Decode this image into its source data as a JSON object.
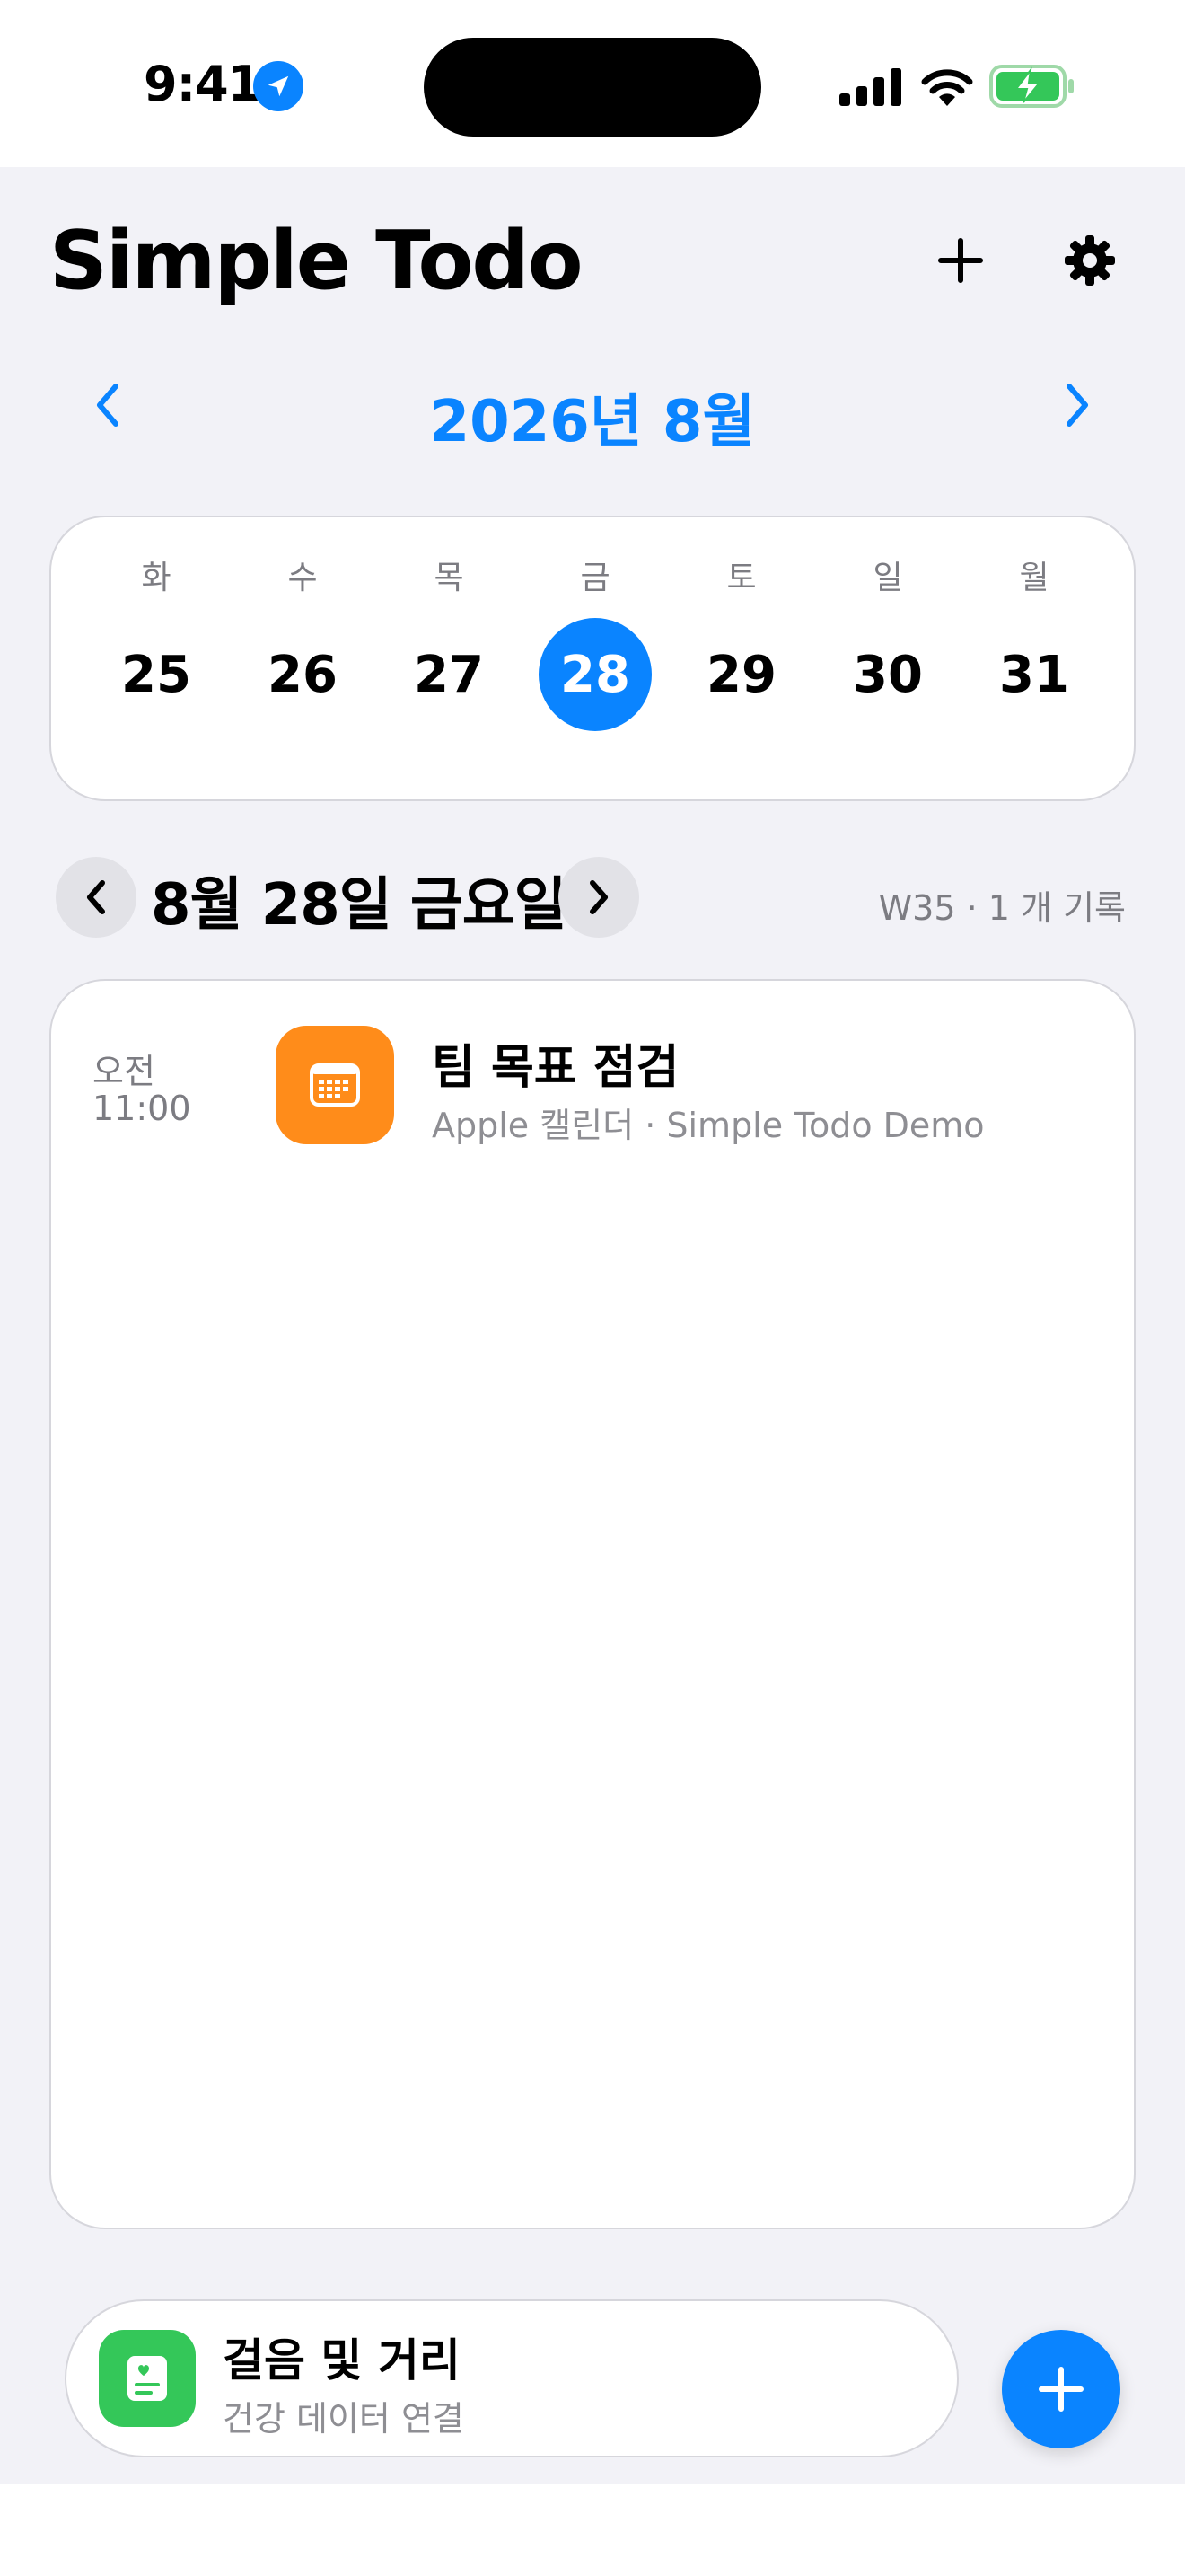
{
  "status_bar": {
    "time": "9:41"
  },
  "header": {
    "title": "Simple Todo"
  },
  "month_nav": {
    "label": "2026년 8월"
  },
  "week": [
    {
      "weekday": "화",
      "day": "25",
      "selected": false
    },
    {
      "weekday": "수",
      "day": "26",
      "selected": false
    },
    {
      "weekday": "목",
      "day": "27",
      "selected": false
    },
    {
      "weekday": "금",
      "day": "28",
      "selected": true
    },
    {
      "weekday": "토",
      "day": "29",
      "selected": false
    },
    {
      "weekday": "일",
      "day": "30",
      "selected": false
    },
    {
      "weekday": "월",
      "day": "31",
      "selected": false
    }
  ],
  "date_nav": {
    "label": "8월 28일 금요일",
    "week_info": "W35 · 1 개 기록"
  },
  "events": [
    {
      "ampm": "오전",
      "time": "11:00",
      "title": "팀 목표 점검",
      "subtitle": "Apple 캘린더 · Simple Todo Demo"
    }
  ],
  "health": {
    "title": "걸음 및 거리",
    "subtitle": "건강 데이터 연결"
  },
  "colors": {
    "accent": "#0a84ff",
    "event_icon": "#ff8c1a",
    "health_icon": "#34c759",
    "background": "#f2f2f7"
  }
}
